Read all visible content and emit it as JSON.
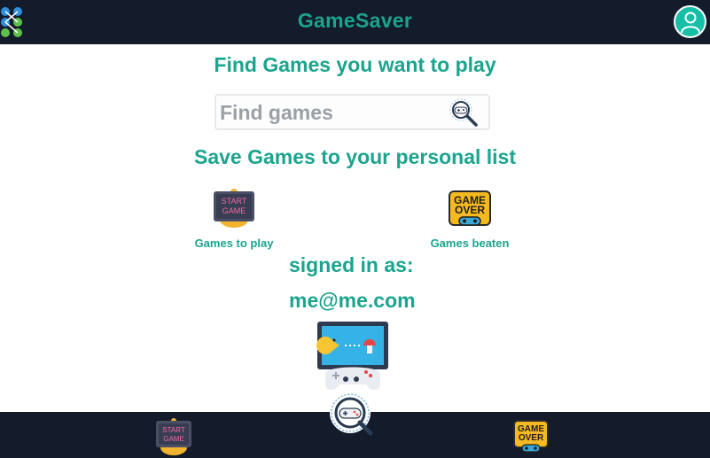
{
  "header": {
    "title": "GameSaver",
    "menu_icon": "apps-grid-icon",
    "avatar_icon": "user-avatar-icon"
  },
  "search": {
    "heading": "Find Games you want to play",
    "placeholder": "Find games",
    "value": "",
    "button_icon": "magnifier-gamepad-icon"
  },
  "lists": {
    "heading": "Save Games to your personal list",
    "items": [
      {
        "label": "Games to play",
        "icon": "start-game-icon",
        "icon_text": [
          "START",
          "GAME"
        ]
      },
      {
        "label": "Games beaten",
        "icon": "game-over-icon",
        "icon_text": [
          "GAME",
          "OVER"
        ]
      }
    ]
  },
  "account": {
    "signed_in_label": "signed in as:",
    "email": "me@me.com"
  },
  "bottom_nav": [
    {
      "icon": "start-game-icon",
      "icon_text": [
        "START",
        "GAME"
      ]
    },
    {
      "icon": "magnifier-gamepad-icon"
    },
    {
      "icon": "game-over-icon",
      "icon_text": [
        "GAME",
        "OVER"
      ]
    }
  ],
  "colors": {
    "accent": "#1ba48e",
    "bar": "#141b2b",
    "avatar": "#16bfa6"
  }
}
